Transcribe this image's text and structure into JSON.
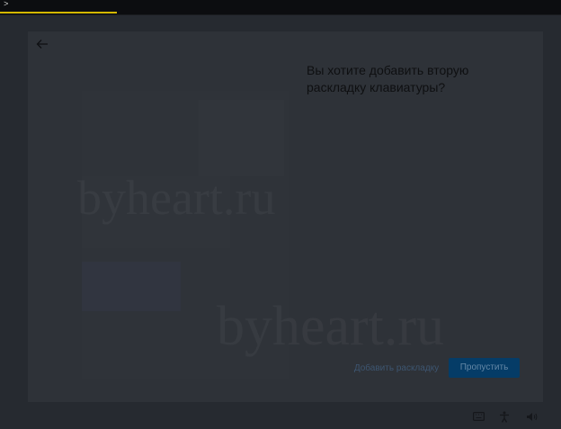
{
  "terminal": {
    "prompt": ">"
  },
  "oobe": {
    "title": "Вы хотите добавить вторую раскладку клавиатуры?",
    "add_layout_label": "Добавить раскладку",
    "skip_label": "Пропустить"
  },
  "watermarks": [
    "byheart.ru",
    "byheart.ru"
  ],
  "tray_icons": [
    "keyboard-icon",
    "accessibility-icon",
    "volume-icon"
  ],
  "colors": {
    "accent": "#053c67",
    "background": "#262a30",
    "card": "#2e3238"
  }
}
